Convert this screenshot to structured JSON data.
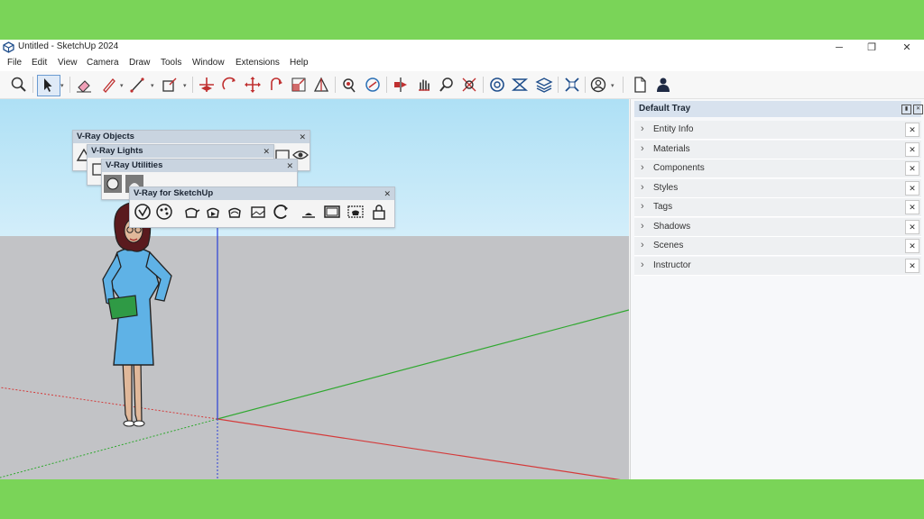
{
  "window": {
    "title": "Untitled - SketchUp 2024"
  },
  "menu": {
    "items": [
      "File",
      "Edit",
      "View",
      "Camera",
      "Draw",
      "Tools",
      "Window",
      "Extensions",
      "Help"
    ]
  },
  "floating_toolbars": {
    "objects": {
      "title": "V-Ray Objects"
    },
    "lights": {
      "title": "V-Ray Lights"
    },
    "utilities": {
      "title": "V-Ray Utilities"
    },
    "main": {
      "title": "V-Ray for SketchUp"
    }
  },
  "tray": {
    "title": "Default Tray",
    "items": [
      "Entity Info",
      "Materials",
      "Components",
      "Styles",
      "Tags",
      "Shadows",
      "Scenes",
      "Instructor"
    ]
  },
  "colors": {
    "background": "#7ad458",
    "sky": "#c6ebfa",
    "ground": "#c2c3c6",
    "axis_red": "#d43a3a",
    "axis_green": "#2fa82f",
    "axis_blue": "#2a3fd8",
    "accent": "#2a6fb5"
  },
  "icons": {
    "toolbar": [
      "search-icon",
      "select-icon",
      "eraser-icon",
      "pencil-icon",
      "line-icon",
      "rectangle-icon",
      "move-icon",
      "rotate-icon",
      "pan-icon",
      "scale-icon",
      "triangle-icon",
      "position-camera-icon",
      "walk-icon",
      "section-icon",
      "orbit-icon",
      "zoom-icon",
      "zoom-extents-icon",
      "vray-asset-icon",
      "vray-render-icon",
      "vray-layers-icon",
      "vray-tools-icon",
      "account-icon",
      "new-file-icon",
      "user-icon"
    ]
  }
}
